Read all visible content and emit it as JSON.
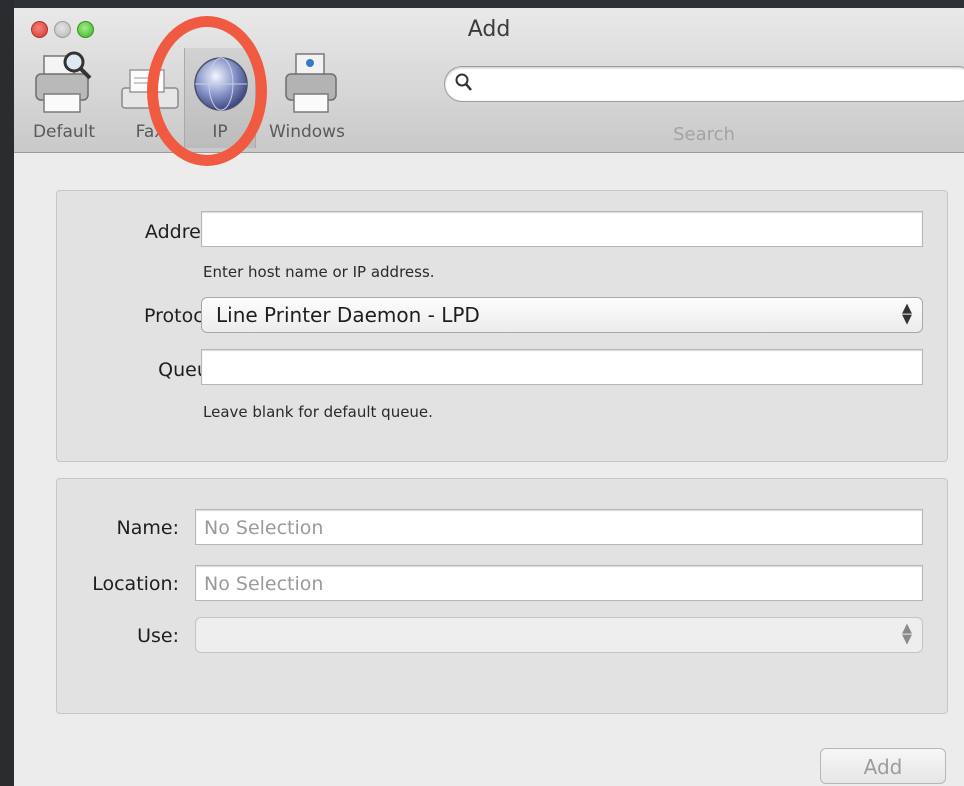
{
  "window": {
    "title": "Add"
  },
  "toolbar": {
    "items": [
      {
        "label": "Default",
        "icon": "printer-magnifier-icon"
      },
      {
        "label": "Fax",
        "icon": "fax-icon"
      },
      {
        "label": "IP",
        "icon": "globe-icon",
        "selected": true
      },
      {
        "label": "Windows",
        "icon": "printer-icon"
      }
    ],
    "search": {
      "value": "",
      "caption": "Search",
      "icon": "search-icon"
    },
    "highlight_color": "#ef5a41"
  },
  "connection": {
    "address_label": "Address:",
    "address_value": "",
    "address_hint": "Enter host name or IP address.",
    "protocol_label": "Protocol:",
    "protocol_value": "Line Printer Daemon - LPD",
    "queue_label": "Queue:",
    "queue_value": "",
    "queue_hint": "Leave blank for default queue."
  },
  "details": {
    "name_label": "Name:",
    "name_placeholder": "No Selection",
    "location_label": "Location:",
    "location_placeholder": "No Selection",
    "use_label": "Use:",
    "use_value": ""
  },
  "footer": {
    "add_label": "Add"
  }
}
